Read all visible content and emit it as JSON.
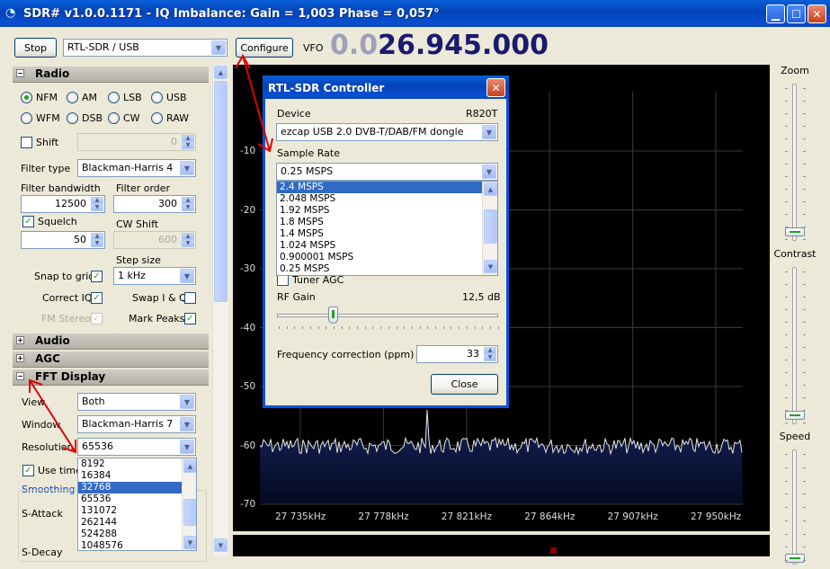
{
  "window": {
    "title": "SDR# v1.0.0.1171 - IQ Imbalance: Gain = 1,003 Phase = 0,057°"
  },
  "toolbar": {
    "stop_label": "Stop",
    "source_value": "RTL-SDR / USB",
    "configure_label": "Configure",
    "vfo_label": "VFO",
    "freq_dim": "0.0",
    "freq_main": "26.945.000"
  },
  "radio": {
    "header": "Radio",
    "modes": [
      "NFM",
      "AM",
      "LSB",
      "USB",
      "WFM",
      "DSB",
      "CW",
      "RAW"
    ],
    "selected_mode": "NFM",
    "shift_label": "Shift",
    "shift_value": "0",
    "filter_type_label": "Filter type",
    "filter_type_value": "Blackman-Harris 4",
    "filter_bandwidth_label": "Filter bandwidth",
    "filter_bandwidth_value": "12500",
    "filter_order_label": "Filter order",
    "filter_order_value": "300",
    "squelch_label": "Squelch",
    "squelch_value": "50",
    "cw_shift_label": "CW Shift",
    "cw_shift_value": "600",
    "step_size_label": "Step size",
    "step_size_value": "1 kHz",
    "snap_label": "Snap to grid",
    "correct_iq_label": "Correct IQ",
    "swap_iq_label": "Swap I & Q",
    "fm_stereo_label": "FM Stereo",
    "mark_peaks_label": "Mark Peaks"
  },
  "audio": {
    "header": "Audio"
  },
  "agc": {
    "header": "AGC"
  },
  "fft": {
    "header": "FFT Display",
    "view_label": "View",
    "view_value": "Both",
    "window_label": "Window",
    "window_value": "Blackman-Harris 7",
    "resolution_label": "Resolution",
    "resolution_value": "65536",
    "resolution_options": [
      "8192",
      "16384",
      "32768",
      "65536",
      "131072",
      "262144",
      "524288",
      "1048576"
    ],
    "resolution_highlight": "32768",
    "use_time_label": "Use",
    "use_time_label2": "time",
    "smoothing_label": "Smoothing",
    "s_attack_label": "S-Attack",
    "s_decay_label": "S-Decay"
  },
  "spectrum": {
    "db_labels": [
      "-10",
      "-20",
      "-30",
      "-40",
      "-50",
      "-60",
      "-70"
    ],
    "freq_labels": [
      "27 735kHz",
      "27 778kHz",
      "27 821kHz",
      "27 864kHz",
      "27 907kHz",
      "27 950kHz"
    ]
  },
  "dialog": {
    "title": "RTL-SDR Controller",
    "device_label": "Device",
    "device_tuner": "R820T",
    "device_value": "ezcap USB 2.0 DVB-T/DAB/FM dongle",
    "sample_rate_label": "Sample Rate",
    "sample_rate_value": "0.25 MSPS",
    "sample_rate_options": [
      "2.4 MSPS",
      "2.048 MSPS",
      "1.92 MSPS",
      "1.8 MSPS",
      "1.4 MSPS",
      "1.024 MSPS",
      "0.900001 MSPS",
      "0.25 MSPS"
    ],
    "sample_rate_highlight": "2.4 MSPS",
    "tuner_agc_label": "Tuner AGC",
    "rf_gain_label": "RF Gain",
    "rf_gain_value": "12,5 dB",
    "rf_gain_fraction": 0.26,
    "freq_corr_label": "Frequency correction (ppm)",
    "freq_corr_value": "33",
    "close_label": "Close"
  },
  "right_panel": {
    "zoom_label": "Zoom",
    "contrast_label": "Contrast",
    "speed_label": "Speed"
  },
  "colors": {
    "title_bar": "#0a5fd8",
    "freq_digits": "#1a1a6e",
    "freq_dim": "#a0a0b8",
    "annotation_arrow": "#e00000",
    "selection": "#316ac5"
  }
}
